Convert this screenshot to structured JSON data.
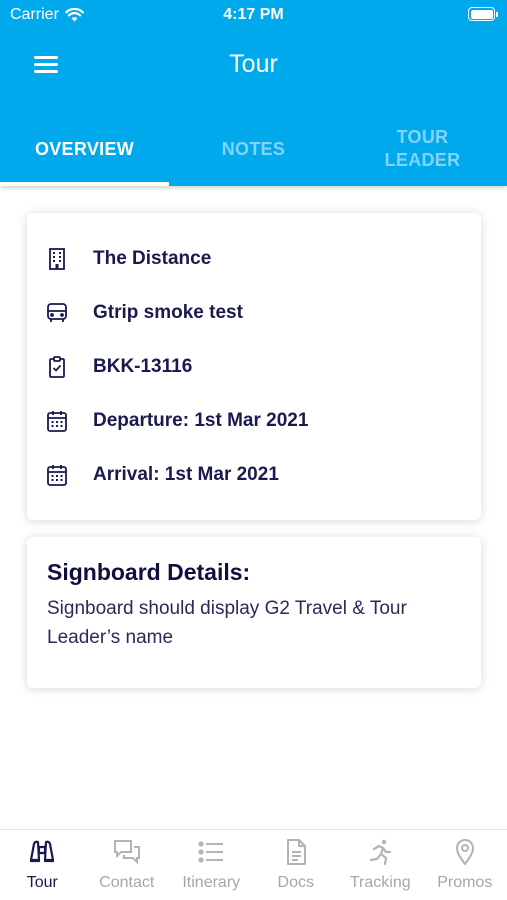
{
  "status_bar": {
    "carrier": "Carrier",
    "time": "4:17 PM"
  },
  "header": {
    "title": "Tour"
  },
  "tabs": [
    {
      "label": "OVERVIEW",
      "active": true
    },
    {
      "label": "NOTES",
      "active": false
    },
    {
      "label": "TOUR\nLEADER",
      "active": false
    }
  ],
  "overview": {
    "rows": [
      {
        "icon": "building-icon",
        "text": "The Distance"
      },
      {
        "icon": "bus-icon",
        "text": "Gtrip smoke test"
      },
      {
        "icon": "clipboard-check-icon",
        "text": "BKK-13116"
      },
      {
        "icon": "calendar-icon",
        "text": "Departure: 1st Mar 2021"
      },
      {
        "icon": "calendar-icon",
        "text": "Arrival: 1st Mar 2021"
      }
    ]
  },
  "signboard": {
    "title": "Signboard Details:",
    "text": "Signboard should display G2 Travel & Tour Leader’s name"
  },
  "bottom_nav": [
    {
      "label": "Tour",
      "icon": "binoculars-icon",
      "active": true
    },
    {
      "label": "Contact",
      "icon": "chat-icon",
      "active": false
    },
    {
      "label": "Itinerary",
      "icon": "list-icon",
      "active": false
    },
    {
      "label": "Docs",
      "icon": "document-icon",
      "active": false
    },
    {
      "label": "Tracking",
      "icon": "running-icon",
      "active": false
    },
    {
      "label": "Promos",
      "icon": "location-pin-icon",
      "active": false
    }
  ],
  "colors": {
    "header": "#00a9ec",
    "text_dark": "#1a1a4f",
    "nav_inactive": "#a6a6a6"
  }
}
